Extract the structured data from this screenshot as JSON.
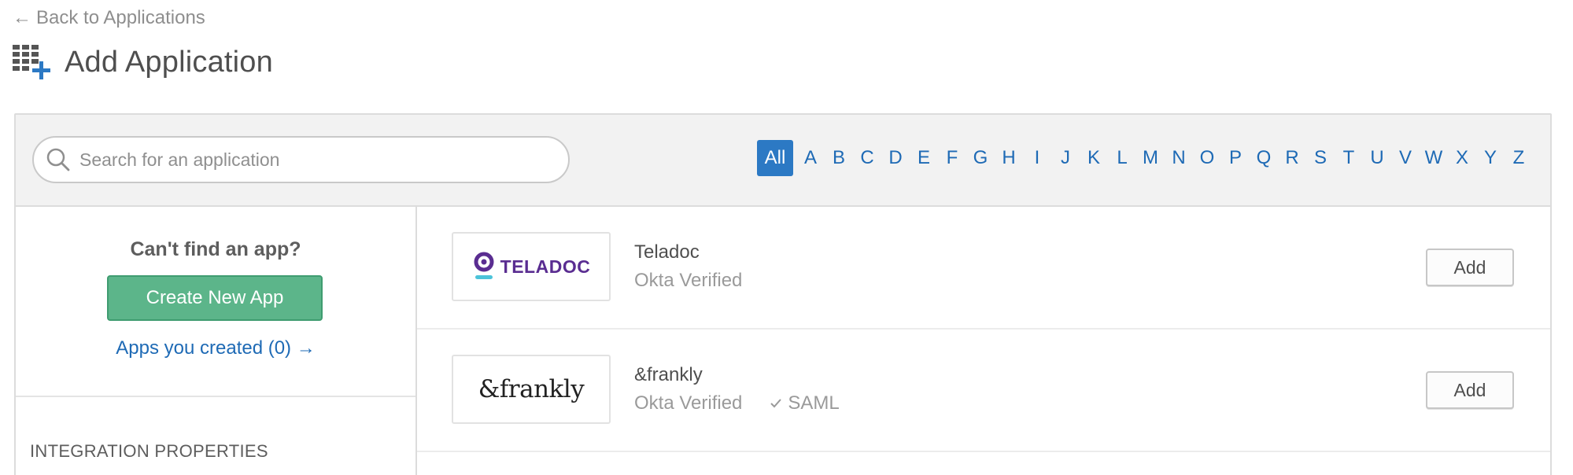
{
  "header": {
    "back_arrow": "←",
    "back_label": "Back to Applications",
    "title": "Add Application"
  },
  "search": {
    "placeholder": "Search for an application",
    "value": ""
  },
  "alpha_filter": {
    "active": "All",
    "letters": [
      "All",
      "A",
      "B",
      "C",
      "D",
      "E",
      "F",
      "G",
      "H",
      "I",
      "J",
      "K",
      "L",
      "M",
      "N",
      "O",
      "P",
      "Q",
      "R",
      "S",
      "T",
      "U",
      "V",
      "W",
      "X",
      "Y",
      "Z"
    ]
  },
  "sidebar": {
    "cant_find": "Can't find an app?",
    "create_label": "Create New App",
    "apps_created_label": "Apps you created (0) →",
    "integration_heading": "INTEGRATION PROPERTIES"
  },
  "apps": [
    {
      "name": "Teladoc",
      "logo_text": "TELADOC",
      "verified": "Okta Verified",
      "protocol": "",
      "add_label": "Add"
    },
    {
      "name": "&frankly",
      "logo_text": "&frankly",
      "verified": "Okta Verified",
      "protocol": "SAML",
      "add_label": "Add"
    }
  ],
  "colors": {
    "link_blue": "#1e6ab5",
    "active_letter_bg": "#2c79c4",
    "create_green": "#5cb58a",
    "teladoc_purple": "#5a2d91",
    "teladoc_teal": "#4cc3d9",
    "toolbar_bg": "#f2f2f2"
  },
  "icons": {
    "back": "left-arrow-icon",
    "title": "app-grid-add-icon",
    "search": "search-icon",
    "saml_check": "check-icon"
  }
}
